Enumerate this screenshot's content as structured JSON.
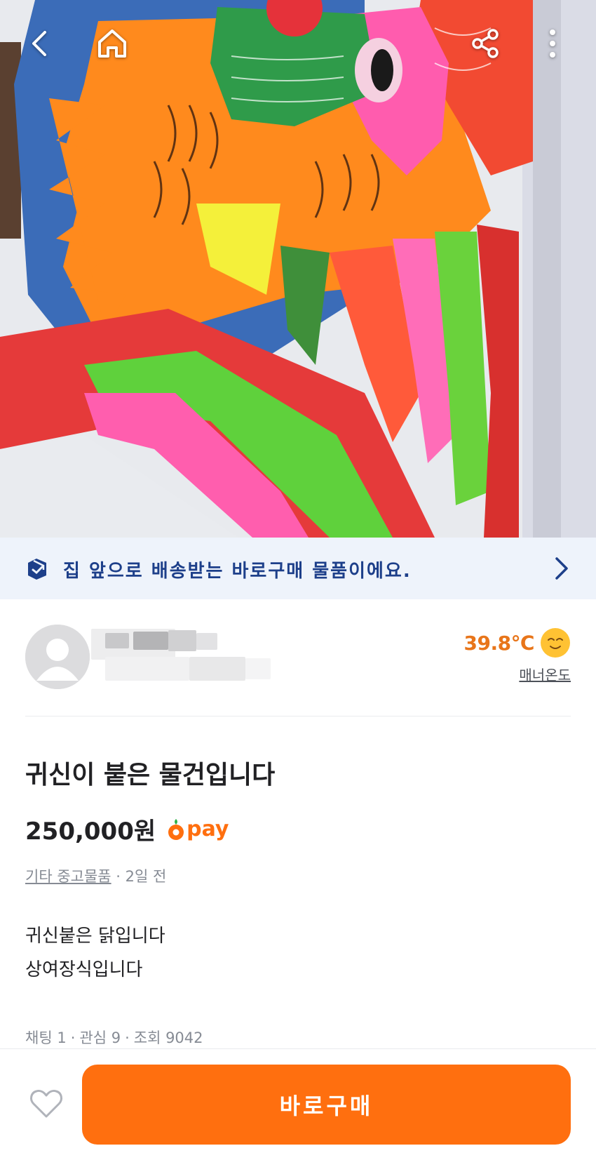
{
  "topbar": {
    "back_icon": "chevron-left-icon",
    "home_icon": "home-icon",
    "share_icon": "share-icon",
    "more_icon": "more-vertical-icon"
  },
  "delivery_banner": {
    "text": "집 앞으로 배송받는 바로구매 물품이에요.",
    "icon": "delivery-box-icon",
    "color": "#1d3f8a"
  },
  "seller": {
    "name": "",
    "manner_temperature": "39.8℃",
    "manner_label": "매너온도"
  },
  "article": {
    "title": "귀신이 붙은 물건입니다",
    "price": "250,000원",
    "pay_label": "pay",
    "category": "기타 중고물품",
    "posted": "2일 전",
    "description": [
      "귀신붙은 닭입니다",
      "상여장식입니다"
    ],
    "stats": {
      "chats": "채팅 1",
      "likes": "관심 9",
      "views": "조회 9042"
    }
  },
  "bottom": {
    "buy_label": "바로구매"
  },
  "colors": {
    "accent": "#ff6f0f",
    "banner_bg": "#eef3fb",
    "temperature": "#e8751a"
  }
}
